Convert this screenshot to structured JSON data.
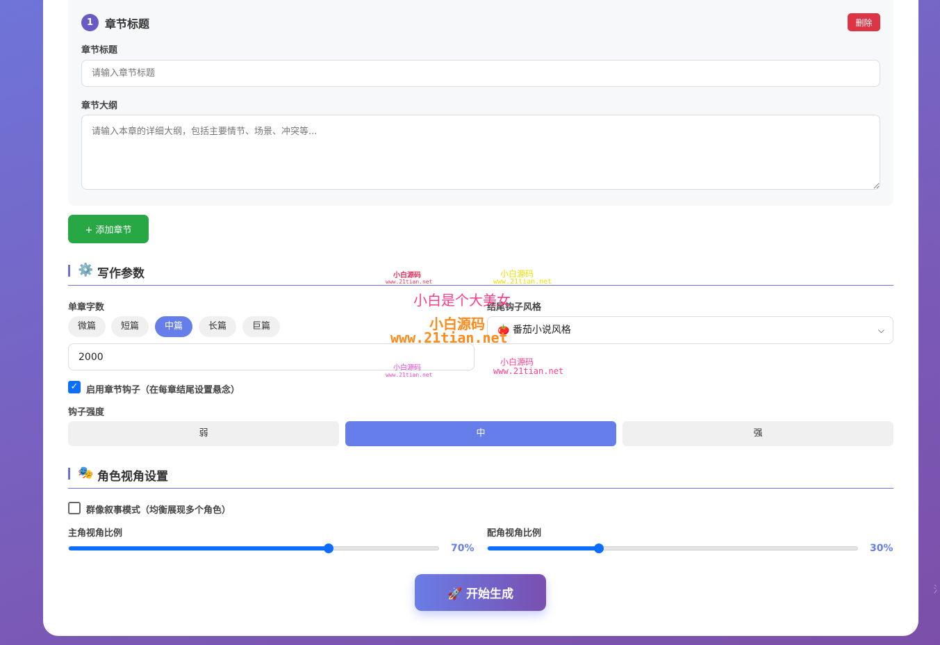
{
  "chapter": {
    "number": "1",
    "title": "章节标题",
    "delete_label": "删除",
    "title_field_label": "章节标题",
    "title_placeholder": "请输入章节标题",
    "outline_label": "章节大纲",
    "outline_placeholder": "请输入本章的详细大纲，包括主要情节、场景、冲突等..."
  },
  "add_chapter_label": "+ 添加章节",
  "writing_params": {
    "heading": "写作参数",
    "icon": "gear-icon",
    "word_count_label": "单章字数",
    "length_options": [
      "微篇",
      "短篇",
      "中篇",
      "长篇",
      "巨篇"
    ],
    "selected_length": "中篇",
    "word_count_value": "2000",
    "ending_hook_label": "结尾钩子风格",
    "ending_hook_value": "🍅 番茄小说风格",
    "enable_hook_label": "启用章节钩子（在每章结尾设置悬念）",
    "enable_hook_checked": true,
    "hook_strength_label": "钩子强度",
    "hook_strength_options": [
      "弱",
      "中",
      "强"
    ],
    "hook_strength_selected": "中"
  },
  "perspective": {
    "heading": "角色视角设置",
    "icon": "masks-icon",
    "ensemble_label": "群像叙事模式（均衡展现多个角色）",
    "ensemble_checked": false,
    "protagonist_label": "主角视角比例",
    "protagonist_value": 0.7,
    "protagonist_text": "70%",
    "supporting_label": "配角视角比例",
    "supporting_value": 0.3,
    "supporting_text": "30%"
  },
  "generate_label": "🚀 开始生成",
  "watermarks": {
    "main": "小白是个大美女",
    "brand": "小白源码",
    "url": "www.21tian.net"
  },
  "colors": {
    "accent": "#667eea",
    "danger": "#dc3545",
    "success": "#28a745",
    "primary": "#0d6efd"
  }
}
